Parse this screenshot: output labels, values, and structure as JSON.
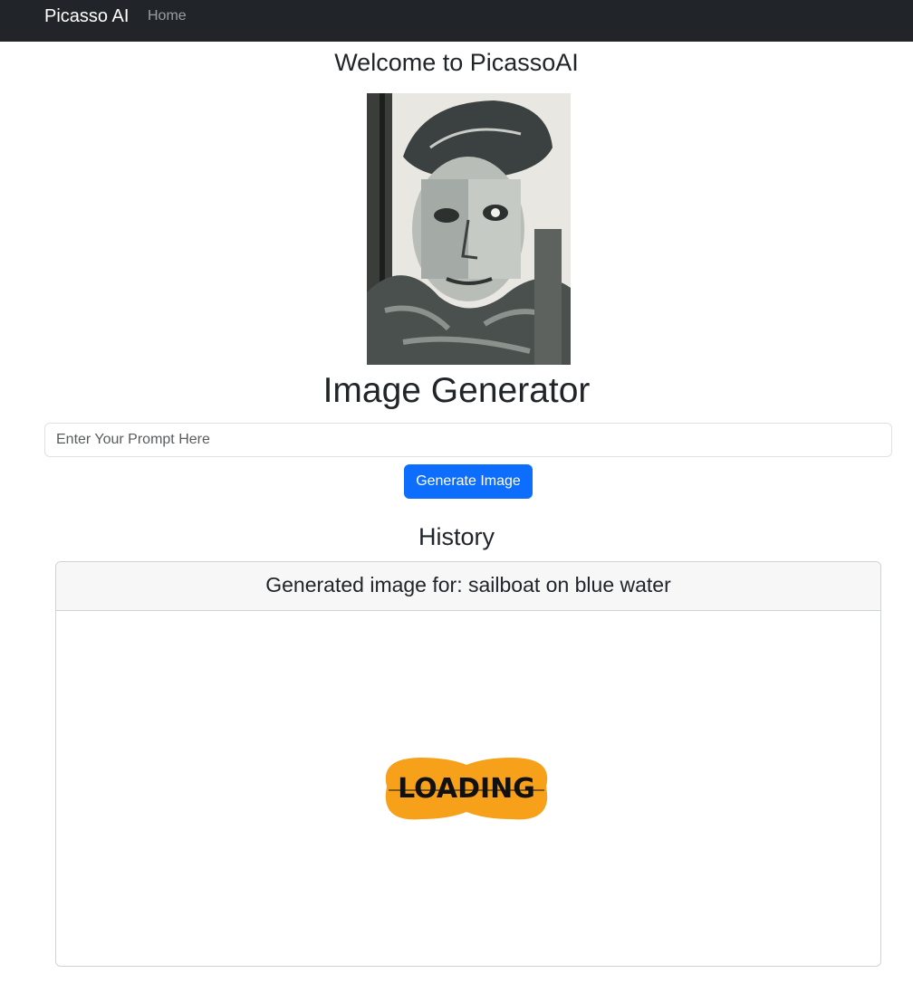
{
  "navbar": {
    "brand": "Picasso AI",
    "links": [
      "Home"
    ]
  },
  "main": {
    "welcome_title": "Welcome to PicassoAI",
    "generator_title": "Image Generator",
    "prompt_placeholder": "Enter Your Prompt Here",
    "prompt_value": "",
    "generate_button": "Generate Image"
  },
  "history": {
    "title": "History",
    "items": [
      {
        "header": "Generated image for: sailboat on blue water",
        "status_image_text": "LOADING"
      }
    ]
  },
  "colors": {
    "navbar_bg": "#212529",
    "primary": "#0d6efd",
    "loading_blob": "#f7a01a"
  },
  "icons": {
    "portrait": "picasso-portrait-image",
    "loading": "loading-graphic"
  }
}
